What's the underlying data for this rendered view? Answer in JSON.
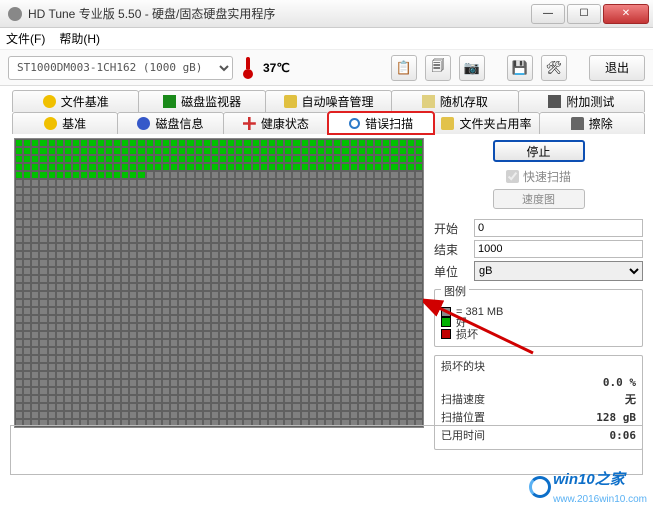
{
  "window": {
    "title": "HD Tune 专业版 5.50 - 硬盘/固态硬盘实用程序"
  },
  "menu": {
    "file": "文件(F)",
    "help": "帮助(H)"
  },
  "toolbar": {
    "drive": "ST1000DM003-1CH162 (1000 gB)",
    "temp": "37",
    "temp_unit": "℃",
    "exit": "退出"
  },
  "tabs_row1": {
    "t1": "文件基准",
    "t2": "磁盘监视器",
    "t3": "自动噪音管理",
    "t4": "随机存取",
    "t5": "附加测试"
  },
  "tabs_row2": {
    "t1": "基准",
    "t2": "磁盘信息",
    "t3": "健康状态",
    "t4": "错误扫描",
    "t5": "文件夹占用率",
    "t6": "擦除"
  },
  "side": {
    "stop": "停止",
    "quick": "快速扫描",
    "speedmap": "速度图",
    "start_lbl": "开始",
    "start_val": "0",
    "end_lbl": "结束",
    "end_val": "1000",
    "unit_lbl": "单位",
    "unit_val": "gB"
  },
  "legend": {
    "title": "图例",
    "block": "= 381 MB",
    "good": "好",
    "bad": "损坏"
  },
  "damaged": {
    "title": "损坏的块",
    "pct": "0.0 %",
    "speed_lbl": "扫描速度",
    "speed_val": "无",
    "pos_lbl": "扫描位置",
    "pos_val": "128 gB",
    "time_lbl": "已用时间",
    "time_val": "0:06"
  },
  "watermark": {
    "big": "win10",
    "suffix": "之家",
    "url": "www.2016win10.com"
  },
  "chart_data": {
    "type": "heatmap",
    "description": "Error-scan block map of a 1000 GB drive. Each cell ≈ 381 MB. Scan in progress.",
    "cols": 50,
    "rows": 36,
    "scanned_good_rows": 4,
    "scanned_good_extra_cols_on_next_row": 16,
    "legend": {
      "gray": "unscanned",
      "green": "good",
      "red": "damaged"
    },
    "damaged_blocks": 0
  }
}
